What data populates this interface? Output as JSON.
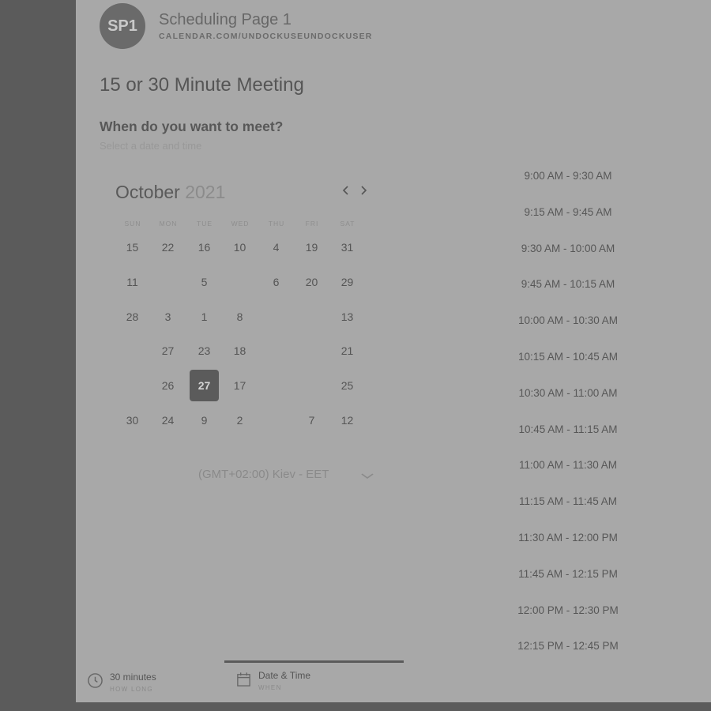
{
  "header": {
    "avatar_initials": "SP1",
    "page_name": "Scheduling Page 1",
    "page_url": "CALENDAR.COM/UNDOCKUSEUNDOCKUSER"
  },
  "meeting_title": "15 or 30 Minute Meeting",
  "question": "When do you want to meet?",
  "sub_question": "Select a date and time",
  "calendar": {
    "month": "October",
    "year": "2021",
    "prev_icon": "chevron-left-icon",
    "next_icon": "chevron-right-icon",
    "weekdays": [
      "SUN",
      "MON",
      "TUE",
      "WED",
      "THU",
      "FRI",
      "SAT"
    ],
    "weeks": [
      [
        {
          "label": "15",
          "state": "available"
        },
        {
          "label": "22",
          "state": "available"
        },
        {
          "label": "16",
          "state": "available"
        },
        {
          "label": "10",
          "state": "available"
        },
        {
          "label": "4",
          "state": "available"
        },
        {
          "label": "19",
          "state": "available"
        },
        {
          "label": "31",
          "state": "available"
        }
      ],
      [
        {
          "label": "11",
          "state": "available"
        },
        {
          "label": "",
          "state": "disabled"
        },
        {
          "label": "5",
          "state": "available"
        },
        {
          "label": "",
          "state": "disabled"
        },
        {
          "label": "6",
          "state": "available"
        },
        {
          "label": "20",
          "state": "available"
        },
        {
          "label": "29",
          "state": "available"
        }
      ],
      [
        {
          "label": "28",
          "state": "available"
        },
        {
          "label": "3",
          "state": "available"
        },
        {
          "label": "1",
          "state": "available"
        },
        {
          "label": "8",
          "state": "available"
        },
        {
          "label": "",
          "state": "disabled"
        },
        {
          "label": "",
          "state": "disabled"
        },
        {
          "label": "13",
          "state": "available"
        }
      ],
      [
        {
          "label": "",
          "state": "disabled"
        },
        {
          "label": "27",
          "state": "available"
        },
        {
          "label": "23",
          "state": "available"
        },
        {
          "label": "18",
          "state": "available"
        },
        {
          "label": "",
          "state": "disabled"
        },
        {
          "label": "",
          "state": "disabled"
        },
        {
          "label": "21",
          "state": "available"
        }
      ],
      [
        {
          "label": "",
          "state": "disabled"
        },
        {
          "label": "26",
          "state": "available"
        },
        {
          "label": "27",
          "state": "selected"
        },
        {
          "label": "17",
          "state": "available"
        },
        {
          "label": "",
          "state": "disabled"
        },
        {
          "label": "",
          "state": "disabled"
        },
        {
          "label": "25",
          "state": "available"
        }
      ],
      [
        {
          "label": "30",
          "state": "available"
        },
        {
          "label": "24",
          "state": "available"
        },
        {
          "label": "9",
          "state": "available"
        },
        {
          "label": "2",
          "state": "available"
        },
        {
          "label": "",
          "state": "disabled"
        },
        {
          "label": "7",
          "state": "available"
        },
        {
          "label": "12",
          "state": "available"
        }
      ]
    ]
  },
  "timezone": {
    "value": "(GMT+02:00) Kiev - EET",
    "icon": "chevron-down-icon"
  },
  "time_slots": [
    "9:00 AM - 9:30 AM",
    "9:15 AM - 9:45 AM",
    "9:30 AM - 10:00 AM",
    "9:45 AM - 10:15 AM",
    "10:00 AM - 10:30 AM",
    "10:15 AM - 10:45 AM",
    "10:30 AM - 11:00 AM",
    "10:45 AM - 11:15 AM",
    "11:00 AM - 11:30 AM",
    "11:15 AM - 11:45 AM",
    "11:30 AM - 12:00 PM",
    "11:45 AM - 12:15 PM",
    "12:00 PM - 12:30 PM",
    "12:15 PM - 12:45 PM"
  ],
  "steps": [
    {
      "label": "30 minutes",
      "sub": "HOW LONG",
      "icon": "clock-icon"
    },
    {
      "label": "Date & Time",
      "sub": "WHEN",
      "icon": "calendar-icon"
    }
  ],
  "colors": {
    "panel_bg": "#a8a8a8",
    "backdrop": "#5b5b5b",
    "selected_day": "#5b5b5b"
  }
}
